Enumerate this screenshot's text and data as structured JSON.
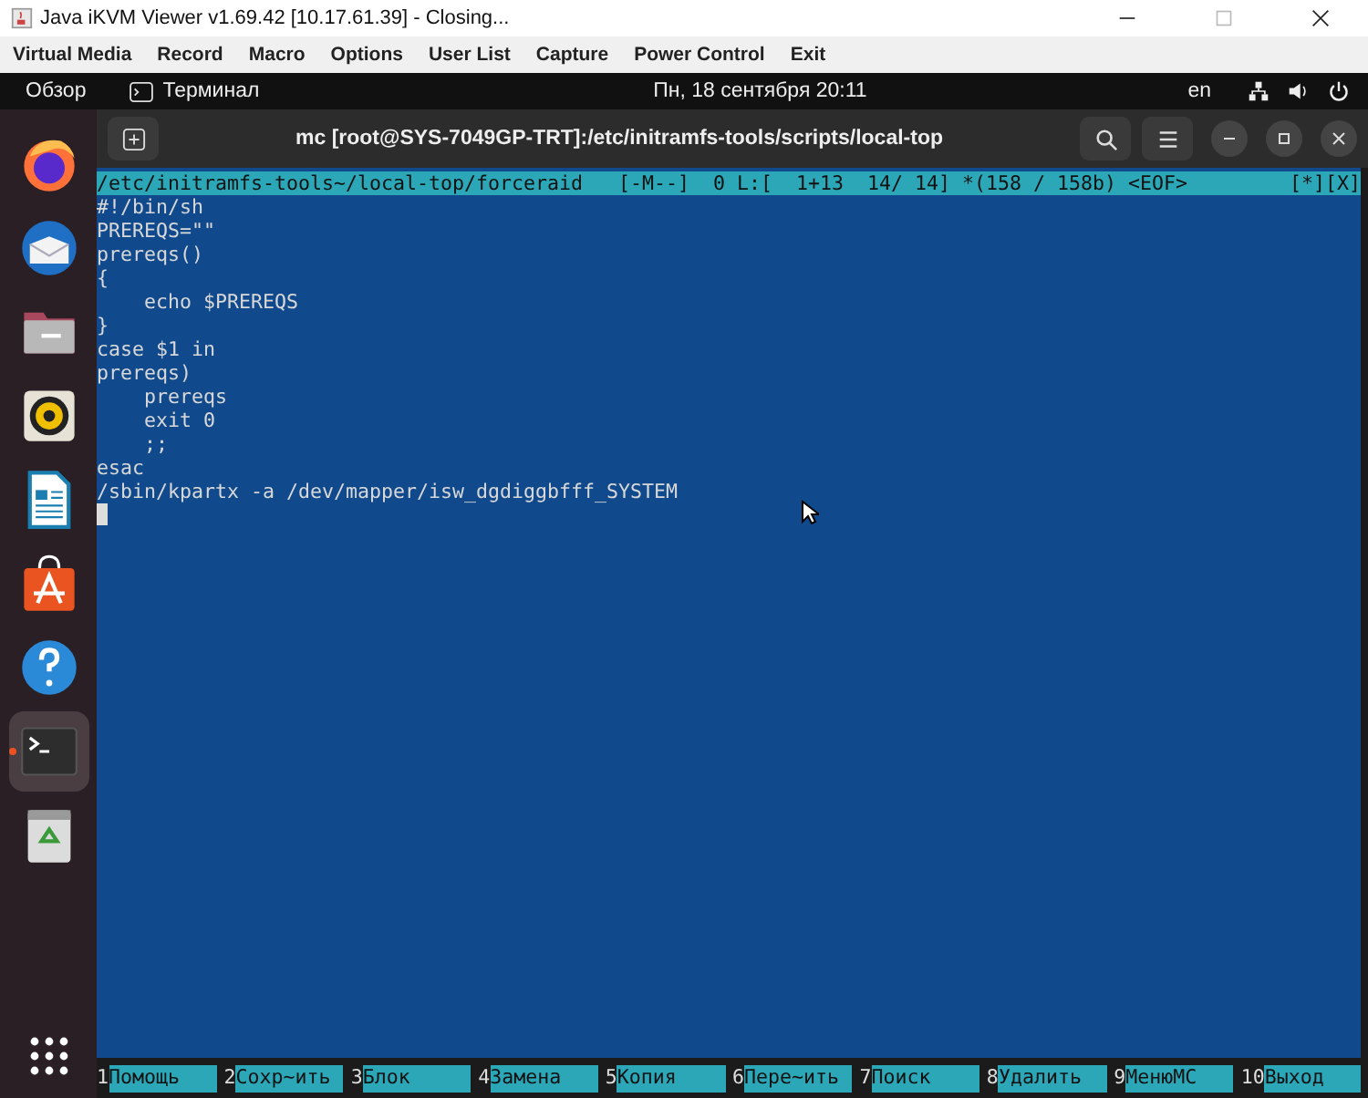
{
  "window": {
    "title": "Java iKVM Viewer v1.69.42 [10.17.61.39]  - Closing..."
  },
  "menu": [
    "Virtual Media",
    "Record",
    "Macro",
    "Options",
    "User List",
    "Capture",
    "Power Control",
    "Exit"
  ],
  "topbar": {
    "activities": "Обзор",
    "app": "Терминал",
    "clock": "Пн, 18 сентября  20:11",
    "language": "en"
  },
  "dock": [
    {
      "kind": "firefox",
      "selected": false,
      "running": false
    },
    {
      "kind": "mail",
      "selected": false,
      "running": false
    },
    {
      "kind": "files",
      "selected": false,
      "running": false
    },
    {
      "kind": "music",
      "selected": false,
      "running": false
    },
    {
      "kind": "writer",
      "selected": false,
      "running": false
    },
    {
      "kind": "store",
      "selected": false,
      "running": false
    },
    {
      "kind": "help",
      "selected": false,
      "running": false
    },
    {
      "kind": "terminal",
      "selected": true,
      "running": true
    },
    {
      "kind": "trash",
      "selected": false,
      "running": false
    }
  ],
  "terminal": {
    "title": "mc [root@SYS-7049GP-TRT]:/etc/initramfs-tools/scripts/local-top",
    "status": "/etc/initramfs-tools~/local-top/forceraid   [-M--]  0 L:[  1+13  14/ 14] *(158 / 158b) <EOF>",
    "status_right": "[*][X]",
    "lines": [
      "#!/bin/sh",
      "PREREQS=\"\"",
      "prereqs()",
      "{",
      "    echo $PREREQS",
      "}",
      "case $1 in",
      "prereqs)",
      "    prereqs",
      "    exit 0",
      "    ;;",
      "esac",
      "/sbin/kpartx -a /dev/mapper/isw_dgdiggbfff_SYSTEM"
    ],
    "fkeys": [
      {
        "num": "1",
        "label": "Помощь"
      },
      {
        "num": "2",
        "label": "Сохр~ить"
      },
      {
        "num": "3",
        "label": "Блок"
      },
      {
        "num": "4",
        "label": "Замена"
      },
      {
        "num": "5",
        "label": "Копия"
      },
      {
        "num": "6",
        "label": "Пере~ить"
      },
      {
        "num": "7",
        "label": "Поиск"
      },
      {
        "num": "8",
        "label": "Удалить"
      },
      {
        "num": "9",
        "label": "МенюMC"
      },
      {
        "num": "10",
        "label": "Выход"
      }
    ]
  }
}
